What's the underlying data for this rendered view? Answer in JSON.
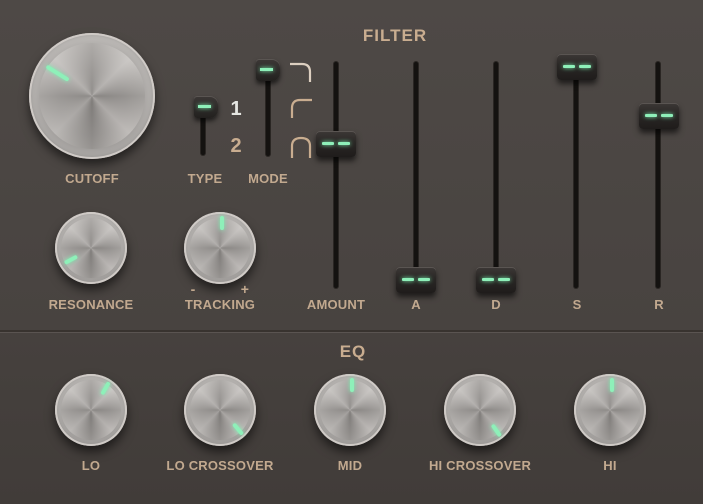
{
  "filter": {
    "title": "FILTER",
    "cutoff_label": "CUTOFF",
    "resonance_label": "RESONANCE",
    "tracking_label": "TRACKING",
    "tracking_minus": "-",
    "tracking_plus": "+",
    "type_label": "TYPE",
    "type_options": [
      "1",
      "2"
    ],
    "type_selected": "1",
    "mode_label": "MODE",
    "mode_icons": [
      "lowpass-curve-icon",
      "highpass-curve-icon",
      "bandpass-curve-icon"
    ],
    "amount_label": "AMOUNT",
    "env_labels": [
      "A",
      "D",
      "S",
      "R"
    ]
  },
  "eq": {
    "title": "EQ",
    "knob_labels": [
      "LO",
      "LO CROSSOVER",
      "MID",
      "HI CROSSOVER",
      "HI"
    ]
  },
  "colors": {
    "accent": "#8ef0b9",
    "label": "#c2a98f",
    "type_inactive": "#c9ad90",
    "background": "#4a4542"
  }
}
